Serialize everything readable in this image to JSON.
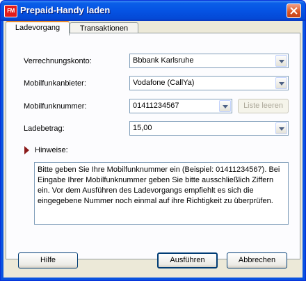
{
  "window": {
    "title": "Prepaid-Handy laden",
    "app_icon_text": "FM"
  },
  "tabs": [
    {
      "label": "Ladevorgang"
    },
    {
      "label": "Transaktionen"
    }
  ],
  "form": {
    "verrechnungskonto": {
      "label": "Verrechnungskonto:",
      "value": "Bbbank Karlsruhe"
    },
    "mobilfunkanbieter": {
      "label": "Mobilfunkanbieter:",
      "value": "Vodafone (CallYa)"
    },
    "mobilfunknummer": {
      "label": "Mobilfunknummer:",
      "value": "01411234567",
      "clear_button": "Liste leeren"
    },
    "ladebetrag": {
      "label": "Ladebetrag:",
      "value": "15,00"
    }
  },
  "hinweise": {
    "label": "Hinweise:",
    "text": "Bitte geben Sie Ihre Mobilfunknummer ein (Beispiel: 01411234567). Bei Eingabe Ihrer Mobilfunknummer geben Sie bitte ausschließlich Ziffern ein. Vor dem Ausführen des Ladevorgangs empfiehlt es sich die eingegebene Nummer noch einmal auf ihre Richtigkeit zu überprüfen."
  },
  "buttons": {
    "help": "Hilfe",
    "execute": "Ausführen",
    "cancel": "Abbrechen"
  },
  "colors": {
    "title_bar": "#0553e3",
    "close_button": "#d9531e",
    "dialog_bg": "#ece9d8",
    "arrow": "#8b1a1a"
  }
}
